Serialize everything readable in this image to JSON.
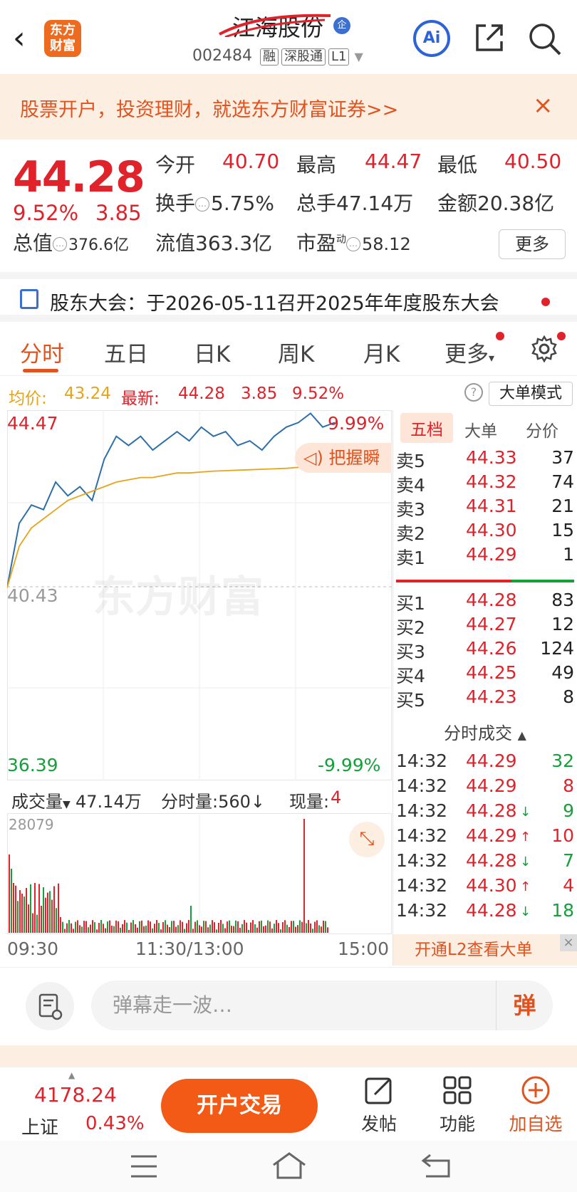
{
  "header": {
    "back": "‹",
    "logo": "东方\n财富",
    "title": "江海股份",
    "badge": "企",
    "code": "002484",
    "tags": [
      "融",
      "深股通",
      "L1"
    ],
    "ai": "Ai"
  },
  "banner": {
    "text": "股票开户，投资理财，就选东方财富证券>>",
    "close": "×"
  },
  "quote": {
    "price": "44.28",
    "pct": "9.52%",
    "change": "3.85",
    "open_label": "今开",
    "open": "40.70",
    "high_label": "最高",
    "high": "44.47",
    "low_label": "最低",
    "low": "40.50",
    "turnover_label": "换手",
    "turnover": "5.75%",
    "volume_label": "总手",
    "volume": "47.14万",
    "amount_label": "金额",
    "amount": "20.38亿",
    "mktcap_label": "总值",
    "mktcap": "376.6亿",
    "float_label": "流值",
    "float": "363.3亿",
    "pe_label": "市盈",
    "pe_sup": "动",
    "pe": "58.12",
    "more": "更多"
  },
  "notice": {
    "text": "股东大会：于2026-05-11召开2025年年度股东大会"
  },
  "tabs": [
    "分时",
    "五日",
    "日K",
    "周K",
    "月K",
    "更多"
  ],
  "avg_row": {
    "avg_label": "均价:",
    "avg": "43.24",
    "latest_label": "最新:",
    "latest": "44.28",
    "change": "3.85",
    "pct": "9.52%",
    "big_order_mode": "大单模式"
  },
  "chart": {
    "high": "44.47",
    "mid": "40.43",
    "low": "36.39",
    "high_pct": "9.99%",
    "low_pct": "-9.99%",
    "watermark": "东方财富",
    "grasp": "把握瞬",
    "vol_label": "成交量",
    "vol_total": "47.14万",
    "period_vol": "分时量:560",
    "now_vol_label": "现量:",
    "now_vol": "4",
    "vol_max": "28079",
    "time_axis": [
      "09:30",
      "11:30/13:00",
      "15:00"
    ]
  },
  "chart_data": {
    "type": "line",
    "series": [
      {
        "values": [
          40.6,
          42.0,
          42.4,
          42.3,
          42.9,
          42.6,
          42.8,
          42.5,
          43.4,
          43.9,
          43.7,
          43.9,
          43.6,
          43.8,
          44.0,
          43.8,
          44.1,
          43.9,
          44.0,
          43.7,
          43.8,
          43.6,
          43.9,
          44.1,
          44.2,
          44.4,
          44.1,
          44.2
        ]
      },
      {
        "values": [
          40.6,
          41.5,
          41.9,
          42.1,
          42.3,
          42.5,
          42.6,
          42.7,
          42.8,
          42.9,
          42.95,
          43.0,
          43.0,
          43.05,
          43.1,
          43.1,
          43.12,
          43.14,
          43.15,
          43.16,
          43.17,
          43.18,
          43.19,
          43.2,
          43.22,
          43.23,
          43.24,
          43.24
        ]
      }
    ],
    "ylim": [
      36.39,
      44.47
    ],
    "volume_max": 28079
  },
  "orderbook": {
    "tabs": [
      "五档",
      "大单",
      "分价"
    ],
    "asks": [
      {
        "label": "卖5",
        "price": "44.33",
        "vol": "37"
      },
      {
        "label": "卖4",
        "price": "44.32",
        "vol": "74"
      },
      {
        "label": "卖3",
        "price": "44.31",
        "vol": "21"
      },
      {
        "label": "卖2",
        "price": "44.30",
        "vol": "15"
      },
      {
        "label": "卖1",
        "price": "44.29",
        "vol": "1"
      }
    ],
    "bids": [
      {
        "label": "买1",
        "price": "44.28",
        "vol": "83"
      },
      {
        "label": "买2",
        "price": "44.27",
        "vol": "12"
      },
      {
        "label": "买3",
        "price": "44.26",
        "vol": "124"
      },
      {
        "label": "买4",
        "price": "44.25",
        "vol": "49"
      },
      {
        "label": "买5",
        "price": "44.23",
        "vol": "8"
      }
    ],
    "ticks_title": "分时成交",
    "ticks": [
      {
        "time": "14:32",
        "price": "44.29",
        "arrow": "",
        "vol": "32",
        "color": "green"
      },
      {
        "time": "14:32",
        "price": "44.29",
        "arrow": "",
        "vol": "8",
        "color": "red"
      },
      {
        "time": "14:32",
        "price": "44.28",
        "arrow": "↓",
        "vol": "9",
        "color": "green"
      },
      {
        "time": "14:32",
        "price": "44.29",
        "arrow": "↑",
        "vol": "10",
        "color": "red"
      },
      {
        "time": "14:32",
        "price": "44.28",
        "arrow": "↓",
        "vol": "7",
        "color": "green"
      },
      {
        "time": "14:32",
        "price": "44.30",
        "arrow": "↑",
        "vol": "4",
        "color": "red"
      },
      {
        "time": "14:32",
        "price": "44.28",
        "arrow": "↓",
        "vol": "18",
        "color": "green"
      }
    ],
    "l2": "开通L2查看大单"
  },
  "danmu": {
    "placeholder": "弹幕走一波…",
    "send": "弹"
  },
  "bottom": {
    "index_value": "4178.24",
    "index_name": "上证",
    "index_pct": "0.43%",
    "trade": "开户交易",
    "post": "发帖",
    "func": "功能",
    "add": "加自选"
  },
  "colors": {
    "up": "#e0222a",
    "down": "#16a03b",
    "accent": "#e0531f",
    "price_line": "#2e6fa8",
    "avg_line": "#e6a31c"
  }
}
